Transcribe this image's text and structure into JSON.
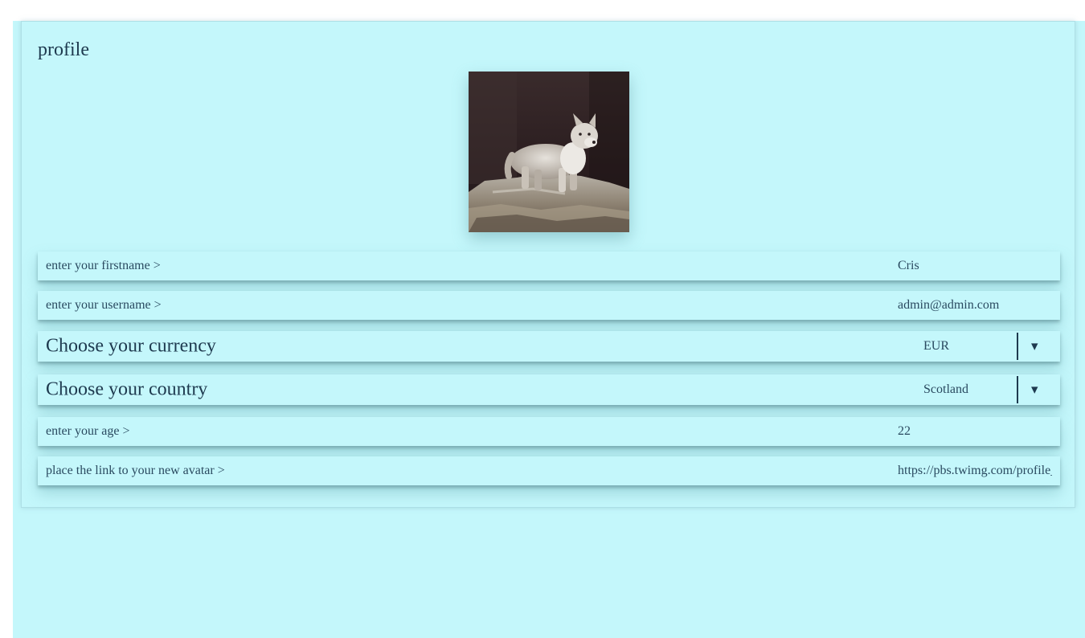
{
  "profile": {
    "title": "profile",
    "avatar_alt": "wolf cub avatar"
  },
  "fields": {
    "firstname": {
      "label": "enter your firstname >",
      "value": "Cris"
    },
    "username": {
      "label": "enter your username >",
      "value": "admin@admin.com"
    },
    "currency": {
      "label": "Choose your currency",
      "value": "EUR"
    },
    "country": {
      "label": "Choose your country",
      "value": "Scotland"
    },
    "age": {
      "label": "enter your age >",
      "value": "22"
    },
    "avatar_link": {
      "label": "place the link to your new avatar >",
      "value": "https://pbs.twimg.com/profile_images/"
    }
  },
  "colors": {
    "background": "#c4f7fb",
    "text": "#2a4a60"
  },
  "icons": {
    "dropdown": "chevron-down-icon"
  }
}
